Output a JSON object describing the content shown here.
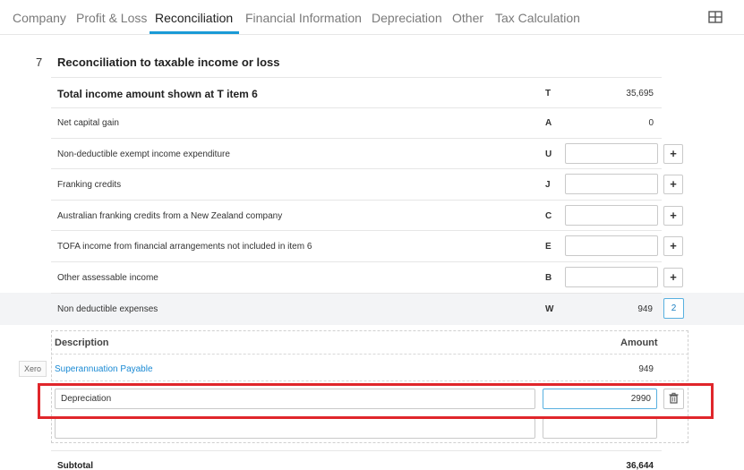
{
  "tabs": [
    {
      "label": "Company",
      "active": false
    },
    {
      "label": "Profit & Loss",
      "active": false
    },
    {
      "label": "Reconciliation",
      "active": true
    },
    {
      "label": "Financial Information",
      "active": false
    },
    {
      "label": "Depreciation",
      "active": false
    },
    {
      "label": "Other",
      "active": false
    },
    {
      "label": "Tax Calculation",
      "active": false
    }
  ],
  "section": {
    "number": "7",
    "title": "Reconciliation to taxable income or loss"
  },
  "rows": [
    {
      "label": "Total income amount shown at T item 6",
      "code": "T",
      "value": "35,695"
    },
    {
      "label": "Net capital gain",
      "code": "A",
      "value": "0"
    },
    {
      "label": "Non-deductible exempt income expenditure",
      "code": "U",
      "value": ""
    },
    {
      "label": "Franking credits",
      "code": "J",
      "value": ""
    },
    {
      "label": "Australian franking credits from a New Zealand company",
      "code": "C",
      "value": ""
    },
    {
      "label": "TOFA income from financial arrangements not included in item 6",
      "code": "E",
      "value": ""
    },
    {
      "label": "Other assessable income",
      "code": "B",
      "value": ""
    },
    {
      "label": "Non deductible expenses",
      "code": "W",
      "value": "949",
      "badge": "2"
    }
  ],
  "plus_label": "+",
  "details": {
    "col_description": "Description",
    "col_amount": "Amount",
    "items": [
      {
        "source": "Xero",
        "description": "Superannuation Payable",
        "amount": "949"
      }
    ],
    "edit_row": {
      "description": "Depreciation",
      "amount": "2990"
    },
    "new_row": {
      "description": "",
      "amount": ""
    }
  },
  "subtotal": {
    "label": "Subtotal",
    "value": "36,644"
  },
  "colors": {
    "accent": "#1a9ad6",
    "link": "#1a8ad4",
    "focus_outline": "#e0262b"
  },
  "icons": {
    "layout": "grid-icon",
    "delete": "trash-icon",
    "add": "plus-icon"
  }
}
